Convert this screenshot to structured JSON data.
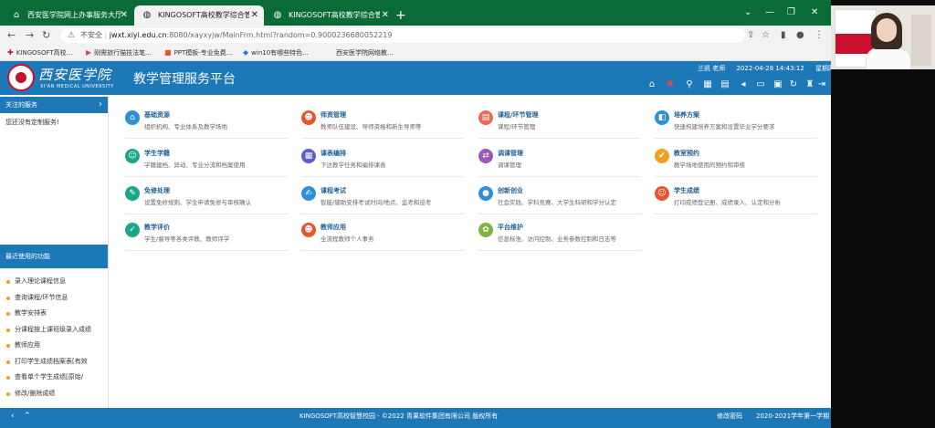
{
  "browser": {
    "tabs": [
      {
        "title": "西安医学院网上办事服务大厅",
        "icon": "home-icon"
      },
      {
        "title": "KINGOSOFT高校教学综合管理服务平台",
        "icon": "globe-icon"
      },
      {
        "title": "KINGOSOFT高校教学综合管理服务平台",
        "icon": "globe-icon"
      }
    ],
    "new_tab": "+",
    "window_controls": {
      "minimize": "⌄",
      "restore": "—",
      "maximize": "❐",
      "close": "✕"
    },
    "security_label": "不安全",
    "url_host": "jwxt.xiyi.edu.cn",
    "url_rest": ":8080/xayxyjw/MainFrm.html?random=0.9000236680052219",
    "bookmarks": [
      {
        "label": "KINGOSOFT高校...",
        "icon": "kingo-icon"
      },
      {
        "label": "刚需旅行猫技法笔...",
        "icon": "bookmark-icon"
      },
      {
        "label": "PPT模板-专业免费...",
        "icon": "ppt-icon"
      },
      {
        "label": "win10有哪些特色...",
        "icon": "bookmark-icon"
      },
      {
        "label": "西安医学院网络教...",
        "icon": "bookmark-icon"
      }
    ]
  },
  "header": {
    "logo_cn": "西安医学院",
    "logo_en": "XI'AN MEDICAL UNIVERSITY",
    "title": "教学管理服务平台",
    "user": "兰凯 老师",
    "datetime": "2022-04-28 14:43:12",
    "weekday": "星期四",
    "icons": [
      "home-icon",
      "shuffle-icon",
      "search-icon",
      "grid-icon",
      "book-icon",
      "volume-icon",
      "window-icon",
      "calendar-icon",
      "reload-icon",
      "shirt-icon",
      "help-icon",
      "logout-icon"
    ]
  },
  "sidebar": {
    "followed_title": "关注的服务",
    "followed_empty": "您还没有定制服务!",
    "recent_title": "最近使用的功能",
    "recent": [
      "录入理论课程信息",
      "查询课程/环节信息",
      "教学安排表",
      "分课程按上课班级录入成绩",
      "教师应用",
      "打印学生成绩档案表[有效",
      "查看单个学生成绩[原始/",
      "修改/删除成绩"
    ]
  },
  "modules": [
    {
      "title": "基础资源",
      "desc": "组织机构、专业体系及教学场地",
      "color": "#2e8fd8",
      "icon": "building-icon",
      "glyph": "⌂"
    },
    {
      "title": "师资管理",
      "desc": "教师队伍建设、导师资格和新生导师等",
      "color": "#e8542e",
      "icon": "teacher-icon",
      "glyph": "☻"
    },
    {
      "title": "课程/环节管理",
      "desc": "课程/环节管理",
      "color": "#e86a5a",
      "icon": "course-icon",
      "glyph": "▤"
    },
    {
      "title": "培养方案",
      "desc": "快速构建培养方案和设置毕业学分要求",
      "color": "#2e8fd8",
      "icon": "plan-icon",
      "glyph": "◧"
    },
    {
      "title": "学生学籍",
      "desc": "学籍建档、异动、专业分流和档案使用",
      "color": "#1aa68a",
      "icon": "student-icon",
      "glyph": "☺"
    },
    {
      "title": "课表编排",
      "desc": "下达教学任务和编排课表",
      "color": "#5b5fc7",
      "icon": "schedule-icon",
      "glyph": "▦"
    },
    {
      "title": "调课管理",
      "desc": "调课管理",
      "color": "#9b59b6",
      "icon": "swap-icon",
      "glyph": "⇄"
    },
    {
      "title": "教室预约",
      "desc": "教学场地使用的预约和审核",
      "color": "#f0a020",
      "icon": "checkbox-icon",
      "glyph": "✔"
    },
    {
      "title": "免修处理",
      "desc": "设置免修规则、学生申请免修与审核确认",
      "color": "#1aa68a",
      "icon": "exempt-icon",
      "glyph": "✎"
    },
    {
      "title": "课程考试",
      "desc": "智能/辅助安排考试时间/地点、监考和巡考",
      "color": "#2e8fd8",
      "icon": "exam-icon",
      "glyph": "✍"
    },
    {
      "title": "创新创业",
      "desc": "社会实践、学科竞赛、大学生科研和学分认定",
      "color": "#2e8fd8",
      "icon": "innovation-icon",
      "glyph": "●"
    },
    {
      "title": "学生成绩",
      "desc": "打印成绩登记册、成绩录入、认定和分析",
      "color": "#e8542e",
      "icon": "grade-icon",
      "glyph": "☺"
    },
    {
      "title": "教学评价",
      "desc": "学生/督导等各类评教、教师评学",
      "color": "#1aa68a",
      "icon": "shield-icon",
      "glyph": "✓"
    },
    {
      "title": "教师应用",
      "desc": "全流程教师个人事务",
      "color": "#e8542e",
      "icon": "teacher-app-icon",
      "glyph": "☻"
    },
    {
      "title": "平台维护",
      "desc": "信息标准、访问控制、业务参数控制和日志等",
      "color": "#7cb342",
      "icon": "gear-icon",
      "glyph": "✿"
    }
  ],
  "footer": {
    "copyright": "KINGOSOFT高校智慧校园 - ©2022  青果软件集团有限公司  版权所有",
    "change_password": "修改密码",
    "term": "2020-2021学年第一学期"
  },
  "overlay": {
    "text": "课程/环节管理"
  }
}
